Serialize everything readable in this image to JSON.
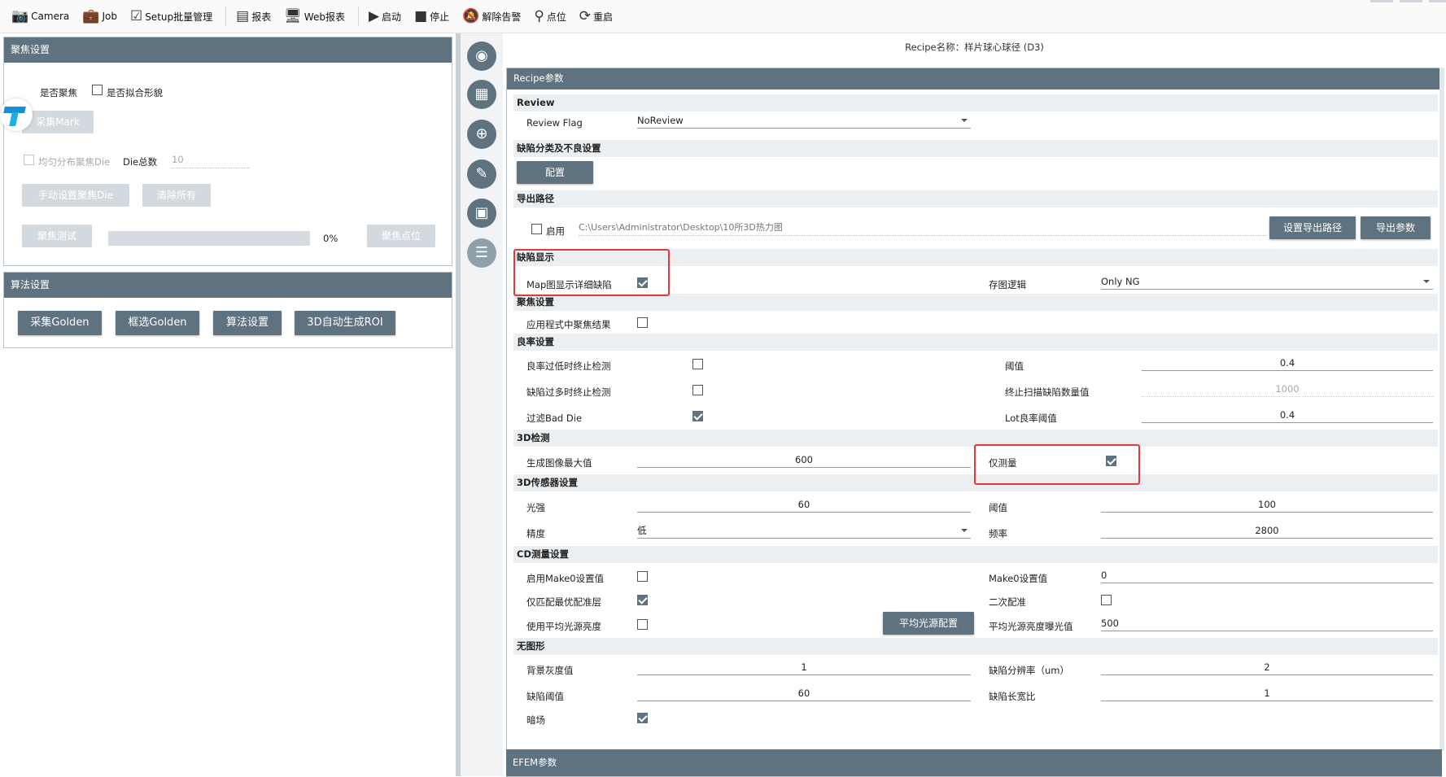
{
  "toolbar": {
    "items": [
      {
        "label": "Camera",
        "icon": "camera-icon"
      },
      {
        "label": "Job",
        "icon": "briefcase-icon"
      },
      {
        "label": "Setup批量管理",
        "icon": "checklist-icon"
      },
      {
        "label": "报表",
        "icon": "report-icon"
      },
      {
        "label": "Web报表",
        "icon": "web-report-icon"
      },
      {
        "label": "启动",
        "icon": "play-icon"
      },
      {
        "label": "停止",
        "icon": "stop-icon"
      },
      {
        "label": "解除告警",
        "icon": "bell-off-icon"
      },
      {
        "label": "点位",
        "icon": "location-pin-icon"
      },
      {
        "label": "重启",
        "icon": "restart-icon"
      }
    ]
  },
  "focus_panel": {
    "title": "聚焦设置",
    "focus_checkbox": "是否聚焦",
    "fit_shape_checkbox": "是否拟合形貌",
    "collect_mark_button": "采集Mark",
    "uniform_die_checkbox": "均匀分布聚焦Die",
    "die_total_label": "Die总数",
    "die_total_value": "10",
    "manual_die_button": "手动设置聚焦Die",
    "clear_all_button": "清除所有",
    "focus_test_button": "聚焦测试",
    "progress_percent": 0,
    "progress_text": "0%",
    "focus_point_button": "聚焦点位"
  },
  "algo_panel": {
    "title": "算法设置",
    "buttons": [
      "采集Golden",
      "框选Golden",
      "算法设置",
      "3D自动生成ROI"
    ]
  },
  "recipe": {
    "name_line": "Recipe名称：样片球心球径 (D3)",
    "header": "Recipe参数",
    "review": {
      "section": "Review",
      "flag_label": "Review Flag",
      "flag_value": "NoReview"
    },
    "defect_class": {
      "section": "缺陷分类及不良设置",
      "config_button": "配置"
    },
    "export": {
      "section": "导出路径",
      "enable_label": "启用",
      "enabled": false,
      "path": "C:\\Users\\Administrator\\Desktop\\10所3D热力图",
      "set_path_button": "设置导出路径",
      "export_params_button": "导出参数"
    },
    "defect_display": {
      "section": "缺陷显示",
      "map_detail_label": "Map图显示详细缺陷",
      "map_detail_checked": true,
      "save_logic_label": "存图逻辑",
      "save_logic_value": "Only NG"
    },
    "focus": {
      "section": "聚焦设置",
      "apply_label": "应用程式中聚焦结果",
      "apply_checked": false
    },
    "yield": {
      "section": "良率设置",
      "low_yield_label": "良率过低时终止检测",
      "low_yield_checked": false,
      "threshold_label": "阈值",
      "threshold_value": "0.4",
      "too_many_label": "缺陷过多时终止检测",
      "too_many_checked": false,
      "stop_count_label": "终止扫描缺陷数量值",
      "stop_count_value": "1000",
      "filter_bad_label": "过滤Bad Die",
      "filter_bad_checked": true,
      "lot_yield_label": "Lot良率阈值",
      "lot_yield_value": "0.4"
    },
    "detect3d": {
      "section": "3D检测",
      "max_label": "生成图像最大值",
      "max_value": "600",
      "measure_only_label": "仅测量",
      "measure_only_checked": true
    },
    "sensor3d": {
      "section": "3D传感器设置",
      "light_label": "光强",
      "light_value": "60",
      "threshold_label": "阈值",
      "threshold_value": "100",
      "precision_label": "精度",
      "precision_value": "低",
      "freq_label": "频率",
      "freq_value": "2800"
    },
    "cd": {
      "section": "CD测量设置",
      "make0_enable_label": "启用Make0设置值",
      "make0_enable_checked": false,
      "make0_value_label": "Make0设置值",
      "make0_value": "0",
      "best_layer_label": "仅匹配最优配准层",
      "best_layer_checked": true,
      "second_align_label": "二次配准",
      "second_align_checked": false,
      "avg_light_label": "使用平均光源亮度",
      "avg_light_checked": false,
      "avg_light_button": "平均光源配置",
      "avg_exposure_label": "平均光源亮度曝光值",
      "avg_exposure_value": "500"
    },
    "nopattern": {
      "section": "无图形",
      "bg_gray_label": "背景灰度值",
      "bg_gray_value": "1",
      "resolution_label": "缺陷分辨率（um）",
      "resolution_value": "2",
      "defect_thr_label": "缺陷阈值",
      "defect_thr_value": "60",
      "aspect_label": "缺陷长宽比",
      "aspect_value": "1",
      "dark_label": "暗场",
      "dark_checked": true
    },
    "efem_header": "EFEM参数"
  },
  "side_icons": [
    "camera-icon",
    "wafer-map-icon",
    "globe-settings-icon",
    "ruler-tool-icon",
    "image-icon",
    "checklist-icon"
  ],
  "colors": {
    "header": "#5f7280",
    "highlight": "#e03a3a"
  }
}
